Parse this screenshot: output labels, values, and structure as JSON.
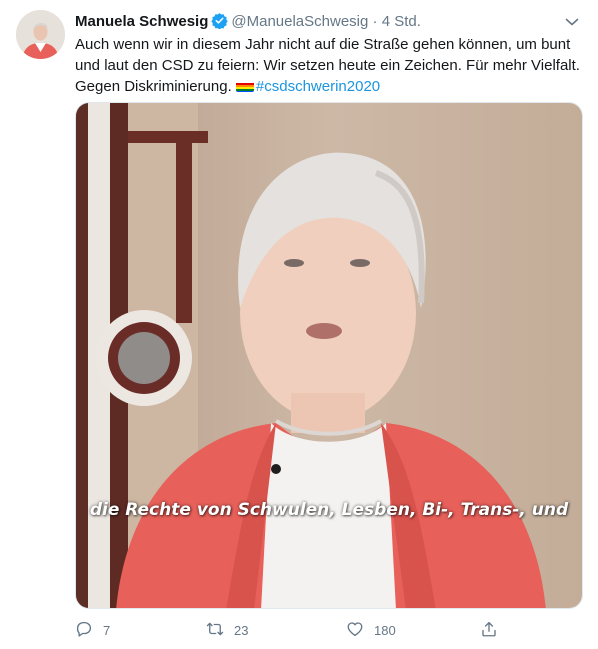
{
  "tweet": {
    "author_name": "Manuela Schwesig",
    "handle": "@ManuelaSchwesig",
    "dot": "·",
    "time": "4 Std.",
    "text_main": "Auch wenn wir in diesem Jahr nicht auf die Straße gehen können, um bunt und laut den CSD zu feiern: Wir setzen heute ein Zeichen. Für mehr Vielfalt. Gegen Diskriminierung.",
    "hashtag": "#csdschwerin2020",
    "video_subtitle": "die Rechte von Schwulen, Lesben, Bi-, Trans-, und",
    "replies": "7",
    "retweets": "23",
    "likes": "180"
  },
  "icons": [
    "verified-badge-icon",
    "chevron-down-icon",
    "rainbow-flag-icon",
    "reply-icon",
    "retweet-icon",
    "like-icon",
    "share-icon"
  ],
  "colors": {
    "accent": "#1b95e0",
    "muted": "#657786",
    "text": "#14171a",
    "jacket": "#e8605a"
  }
}
